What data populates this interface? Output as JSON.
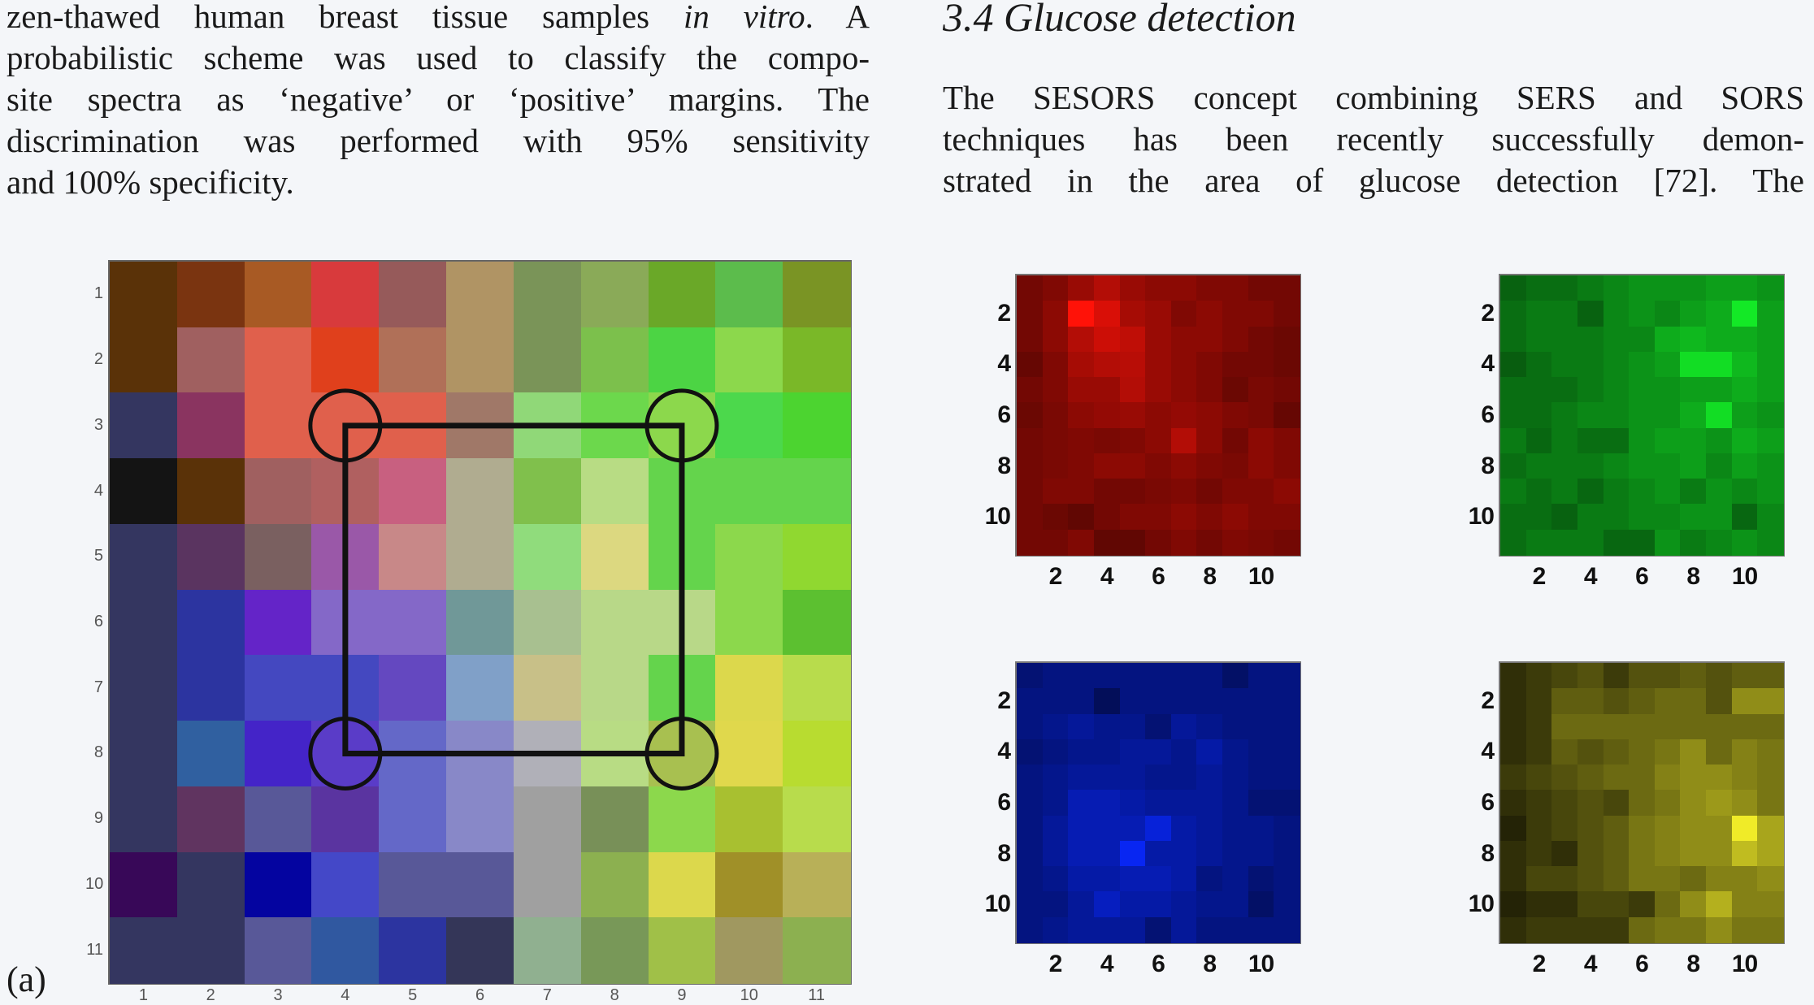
{
  "left_column": {
    "lines": [
      [
        "zen-thawed human breast tissue samples ",
        "in vitro",
        ". A"
      ],
      [
        "probabilistic scheme was used to classify the compo-"
      ],
      [
        "site spectra as ‘negative’ or ‘positive’ margins. The"
      ],
      [
        "discrimination was performed with 95% sensitivity"
      ],
      [
        "and 100% specificity."
      ]
    ]
  },
  "right_column": {
    "heading": "3.4  Glucose detection",
    "lines": [
      "The SESORS concept combining SERS and SORS",
      "techniques has been recently successfully demon-",
      "strated in the area of glucose detection [72]. The"
    ]
  },
  "figure": {
    "panel_label": "(a)"
  },
  "chart_data": [
    {
      "type": "heatmap",
      "x_ticks": [
        "1",
        "2",
        "3",
        "4",
        "5",
        "6",
        "7",
        "8",
        "9",
        "10",
        "11"
      ],
      "y_ticks": [
        "1",
        "2",
        "3",
        "4",
        "5",
        "6",
        "7",
        "8",
        "9",
        "10",
        "11"
      ],
      "cells": [
        [
          "#5a3208",
          "#7a3410",
          "#a85a24",
          "#d83a3c",
          "#965a5a",
          "#b09464",
          "#7a9458",
          "#8aaa58",
          "#6aa828",
          "#5cbc4c",
          "#7a9424"
        ],
        [
          "#5a3208",
          "#a06060",
          "#e0604c",
          "#e0401c",
          "#b07058",
          "#b09464",
          "#7a9458",
          "#7cc04c",
          "#4cd444",
          "#8cd84c",
          "#7ab828"
        ],
        [
          "#343660",
          "#8a3460",
          "#e0604c",
          "#e0604c",
          "#e0604c",
          "#a07868",
          "#90d878",
          "#6cd84c",
          "#8cd84c",
          "#4cd84c",
          "#4cd430"
        ],
        [
          "#141414",
          "#5a3208",
          "#a06060",
          "#b06060",
          "#c86080",
          "#b0ac90",
          "#80c04c",
          "#b8dc84",
          "#64d44c",
          "#64d44c",
          "#64d44c"
        ],
        [
          "#343660",
          "#5a3460",
          "#7a6060",
          "#9a58a8",
          "#c88888",
          "#b0ac90",
          "#90dc7c",
          "#dcd880",
          "#64d44c",
          "#8cd84c",
          "#90d830"
        ],
        [
          "#343660",
          "#2c34a0",
          "#6424c8",
          "#8468c8",
          "#8468c8",
          "#709898",
          "#a8c090",
          "#b8d888",
          "#b8d888",
          "#8cd84c",
          "#5cc030"
        ],
        [
          "#343660",
          "#2c34a0",
          "#4448c0",
          "#4448c0",
          "#6448c0",
          "#80a0c8",
          "#c8c088",
          "#b8d888",
          "#64d44c",
          "#dcd84c",
          "#b8dc4c"
        ],
        [
          "#343660",
          "#3060a0",
          "#4424c8",
          "#5a3cc8",
          "#6468c8",
          "#8888c8",
          "#b0b0b8",
          "#b8dc84",
          "#a8c050",
          "#e0d84c",
          "#b8dc30"
        ],
        [
          "#343660",
          "#603460",
          "#585898",
          "#5a34a0",
          "#6468c8",
          "#8888c8",
          "#a0a0a0",
          "#789058",
          "#8cd84c",
          "#a8c030",
          "#b8dc4c"
        ],
        [
          "#380858",
          "#343660",
          "#0404a0",
          "#4448c8",
          "#585898",
          "#585898",
          "#a0a0a0",
          "#8cb050",
          "#dcd84c",
          "#a09028",
          "#b8b058"
        ],
        [
          "#343660",
          "#343660",
          "#585898",
          "#3058a0",
          "#2c34a0",
          "#343658",
          "#90b090",
          "#789858",
          "#a0c048",
          "#a09860",
          "#8cb050"
        ]
      ],
      "rectangle_corners": [
        [
          4,
          3
        ],
        [
          9,
          3
        ],
        [
          9,
          8
        ],
        [
          4,
          8
        ]
      ],
      "circled_cells": [
        [
          4,
          3
        ],
        [
          9,
          3
        ],
        [
          4,
          8
        ],
        [
          9,
          8
        ]
      ]
    },
    {
      "type": "heatmap",
      "channel": "red",
      "color": "#ff2010",
      "x_ticks": [
        "2",
        "4",
        "6",
        "8",
        "10"
      ],
      "y_ticks": [
        "2",
        "4",
        "6",
        "8",
        "10"
      ],
      "values": [
        [
          0.45,
          0.5,
          0.6,
          0.7,
          0.6,
          0.55,
          0.55,
          0.5,
          0.5,
          0.45,
          0.45
        ],
        [
          0.45,
          0.55,
          1.0,
          0.85,
          0.65,
          0.6,
          0.5,
          0.55,
          0.5,
          0.5,
          0.45
        ],
        [
          0.45,
          0.55,
          0.7,
          0.8,
          0.75,
          0.6,
          0.55,
          0.55,
          0.5,
          0.45,
          0.42
        ],
        [
          0.4,
          0.5,
          0.65,
          0.7,
          0.72,
          0.6,
          0.55,
          0.5,
          0.45,
          0.45,
          0.42
        ],
        [
          0.45,
          0.5,
          0.6,
          0.6,
          0.7,
          0.6,
          0.55,
          0.5,
          0.42,
          0.48,
          0.45
        ],
        [
          0.42,
          0.48,
          0.55,
          0.58,
          0.6,
          0.55,
          0.58,
          0.55,
          0.5,
          0.48,
          0.4
        ],
        [
          0.45,
          0.48,
          0.5,
          0.48,
          0.5,
          0.55,
          0.7,
          0.55,
          0.45,
          0.55,
          0.5
        ],
        [
          0.45,
          0.48,
          0.5,
          0.55,
          0.55,
          0.5,
          0.55,
          0.5,
          0.48,
          0.55,
          0.5
        ],
        [
          0.45,
          0.5,
          0.5,
          0.45,
          0.45,
          0.48,
          0.5,
          0.45,
          0.5,
          0.5,
          0.55
        ],
        [
          0.45,
          0.42,
          0.38,
          0.45,
          0.5,
          0.5,
          0.55,
          0.5,
          0.55,
          0.5,
          0.5
        ],
        [
          0.45,
          0.45,
          0.5,
          0.38,
          0.38,
          0.45,
          0.5,
          0.45,
          0.5,
          0.48,
          0.45
        ]
      ]
    },
    {
      "type": "heatmap",
      "channel": "green",
      "color": "#10ff30",
      "x_ticks": [
        "2",
        "4",
        "6",
        "8",
        "10"
      ],
      "y_ticks": [
        "2",
        "4",
        "6",
        "8",
        "10"
      ],
      "values": [
        [
          0.4,
          0.45,
          0.45,
          0.5,
          0.55,
          0.6,
          0.6,
          0.6,
          0.65,
          0.65,
          0.6
        ],
        [
          0.45,
          0.5,
          0.5,
          0.4,
          0.55,
          0.6,
          0.55,
          0.65,
          0.7,
          0.95,
          0.65
        ],
        [
          0.45,
          0.5,
          0.5,
          0.5,
          0.55,
          0.55,
          0.7,
          0.75,
          0.7,
          0.7,
          0.65
        ],
        [
          0.38,
          0.45,
          0.5,
          0.5,
          0.55,
          0.6,
          0.65,
          0.9,
          0.9,
          0.75,
          0.65
        ],
        [
          0.45,
          0.45,
          0.45,
          0.5,
          0.55,
          0.6,
          0.6,
          0.65,
          0.65,
          0.7,
          0.65
        ],
        [
          0.45,
          0.45,
          0.5,
          0.55,
          0.55,
          0.6,
          0.6,
          0.7,
          0.9,
          0.65,
          0.6
        ],
        [
          0.5,
          0.42,
          0.5,
          0.45,
          0.45,
          0.6,
          0.65,
          0.65,
          0.6,
          0.7,
          0.65
        ],
        [
          0.45,
          0.5,
          0.5,
          0.5,
          0.55,
          0.6,
          0.6,
          0.65,
          0.55,
          0.65,
          0.6
        ],
        [
          0.5,
          0.45,
          0.5,
          0.42,
          0.5,
          0.55,
          0.6,
          0.5,
          0.6,
          0.55,
          0.6
        ],
        [
          0.45,
          0.45,
          0.4,
          0.5,
          0.5,
          0.55,
          0.55,
          0.6,
          0.6,
          0.42,
          0.55
        ],
        [
          0.45,
          0.5,
          0.5,
          0.5,
          0.42,
          0.42,
          0.6,
          0.5,
          0.55,
          0.6,
          0.55
        ]
      ]
    },
    {
      "type": "heatmap",
      "channel": "blue",
      "color": "#1040ff",
      "x_ticks": [
        "2",
        "4",
        "6",
        "8",
        "10"
      ],
      "y_ticks": [
        "2",
        "4",
        "6",
        "8",
        "10"
      ],
      "values": [
        [
          0.45,
          0.5,
          0.5,
          0.5,
          0.5,
          0.5,
          0.5,
          0.5,
          0.4,
          0.5,
          0.5
        ],
        [
          0.5,
          0.5,
          0.5,
          0.35,
          0.5,
          0.5,
          0.5,
          0.5,
          0.5,
          0.5,
          0.5
        ],
        [
          0.5,
          0.55,
          0.6,
          0.55,
          0.55,
          0.45,
          0.6,
          0.55,
          0.5,
          0.5,
          0.5
        ],
        [
          0.45,
          0.5,
          0.55,
          0.55,
          0.6,
          0.6,
          0.55,
          0.65,
          0.55,
          0.5,
          0.5
        ],
        [
          0.5,
          0.55,
          0.6,
          0.6,
          0.6,
          0.55,
          0.55,
          0.6,
          0.55,
          0.5,
          0.5
        ],
        [
          0.5,
          0.55,
          0.7,
          0.7,
          0.65,
          0.6,
          0.6,
          0.6,
          0.55,
          0.45,
          0.45
        ],
        [
          0.5,
          0.6,
          0.7,
          0.7,
          0.7,
          0.85,
          0.65,
          0.6,
          0.55,
          0.55,
          0.5
        ],
        [
          0.5,
          0.6,
          0.7,
          0.7,
          0.95,
          0.65,
          0.65,
          0.6,
          0.55,
          0.55,
          0.5
        ],
        [
          0.5,
          0.55,
          0.65,
          0.65,
          0.7,
          0.7,
          0.65,
          0.5,
          0.55,
          0.45,
          0.5
        ],
        [
          0.5,
          0.5,
          0.6,
          0.75,
          0.65,
          0.65,
          0.6,
          0.55,
          0.55,
          0.4,
          0.5
        ],
        [
          0.5,
          0.55,
          0.6,
          0.6,
          0.6,
          0.45,
          0.6,
          0.5,
          0.5,
          0.5,
          0.5
        ]
      ]
    },
    {
      "type": "heatmap",
      "channel": "yellow",
      "color": "#f0f030",
      "x_ticks": [
        "2",
        "4",
        "6",
        "8",
        "10"
      ],
      "y_ticks": [
        "2",
        "4",
        "6",
        "8",
        "10"
      ],
      "values": [
        [
          0.2,
          0.25,
          0.3,
          0.35,
          0.25,
          0.35,
          0.35,
          0.4,
          0.35,
          0.4,
          0.4
        ],
        [
          0.2,
          0.25,
          0.4,
          0.4,
          0.35,
          0.4,
          0.45,
          0.45,
          0.35,
          0.6,
          0.6
        ],
        [
          0.2,
          0.25,
          0.45,
          0.45,
          0.45,
          0.45,
          0.45,
          0.45,
          0.45,
          0.45,
          0.45
        ],
        [
          0.2,
          0.25,
          0.4,
          0.35,
          0.4,
          0.45,
          0.5,
          0.6,
          0.45,
          0.55,
          0.5
        ],
        [
          0.25,
          0.3,
          0.35,
          0.4,
          0.45,
          0.45,
          0.55,
          0.6,
          0.6,
          0.55,
          0.5
        ],
        [
          0.2,
          0.25,
          0.3,
          0.35,
          0.3,
          0.45,
          0.5,
          0.6,
          0.65,
          0.6,
          0.5
        ],
        [
          0.15,
          0.25,
          0.3,
          0.35,
          0.4,
          0.5,
          0.55,
          0.6,
          0.6,
          1.0,
          0.7
        ],
        [
          0.2,
          0.25,
          0.2,
          0.35,
          0.4,
          0.5,
          0.55,
          0.6,
          0.6,
          0.8,
          0.7
        ],
        [
          0.2,
          0.3,
          0.3,
          0.35,
          0.4,
          0.5,
          0.5,
          0.45,
          0.55,
          0.55,
          0.6
        ],
        [
          0.15,
          0.2,
          0.2,
          0.3,
          0.3,
          0.25,
          0.45,
          0.6,
          0.75,
          0.55,
          0.55
        ],
        [
          0.2,
          0.25,
          0.25,
          0.25,
          0.25,
          0.45,
          0.5,
          0.5,
          0.6,
          0.5,
          0.5
        ]
      ]
    }
  ]
}
